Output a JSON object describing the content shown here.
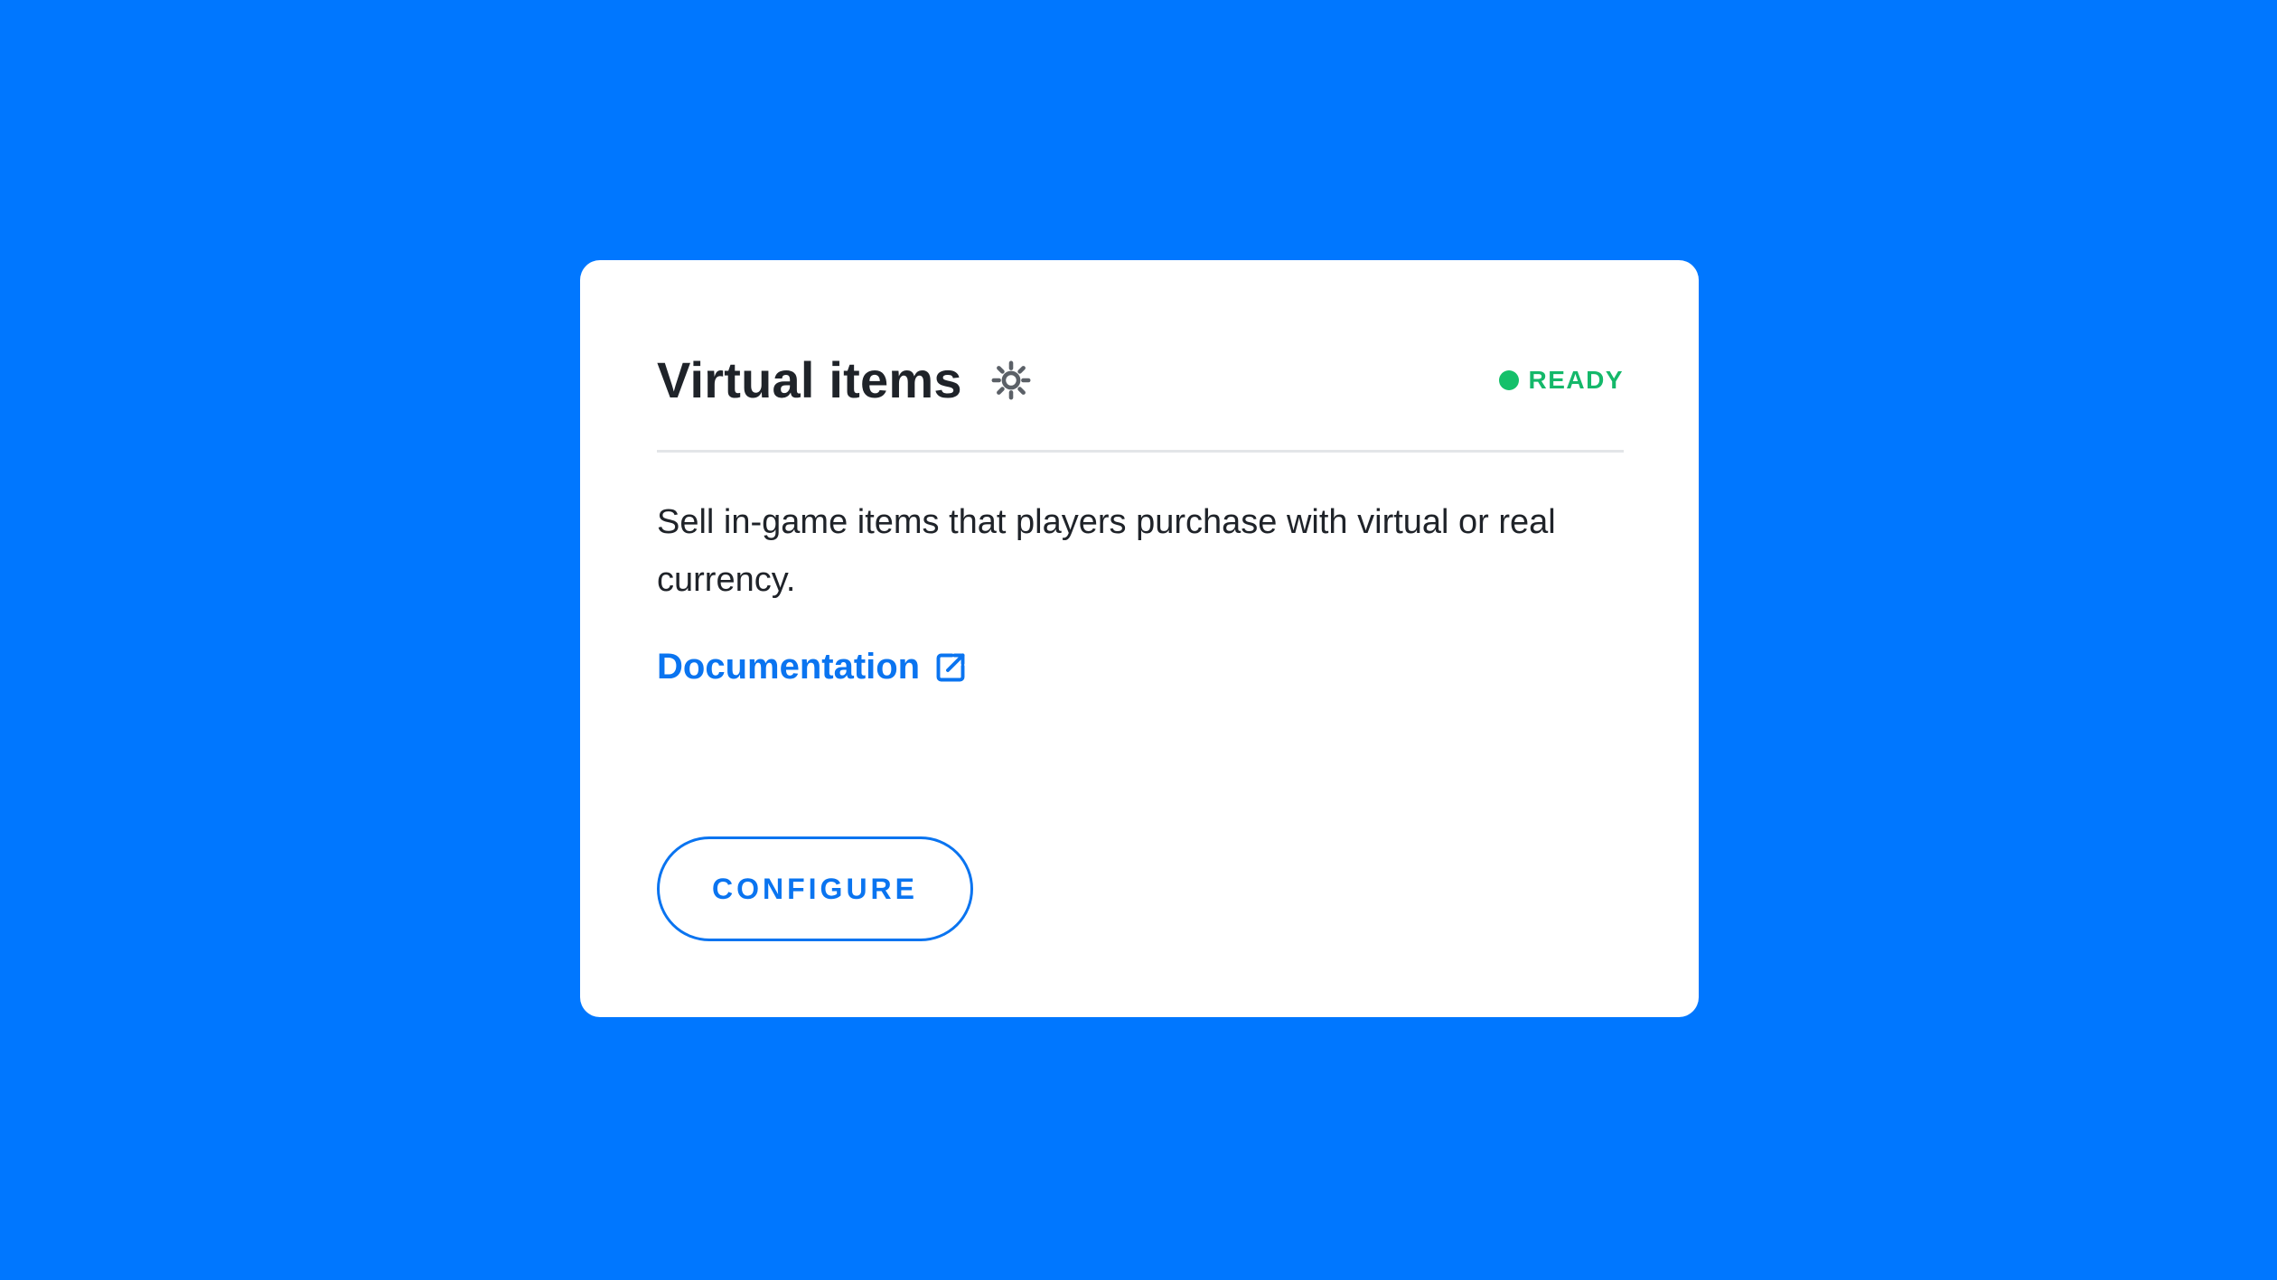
{
  "card": {
    "title": "Virtual items",
    "settings_icon": "gear-icon",
    "status": {
      "label": "READY",
      "color": "#14C06A"
    },
    "description": "Sell in-game items that players purchase with virtual or real currency.",
    "documentation_link": {
      "label": "Documentation",
      "icon": "external-link-icon"
    },
    "configure_button": {
      "label": "CONFIGURE"
    }
  },
  "colors": {
    "background": "#0077FF",
    "accent": "#0A74F0",
    "status_ready": "#14C06A",
    "text": "#1F2329"
  }
}
